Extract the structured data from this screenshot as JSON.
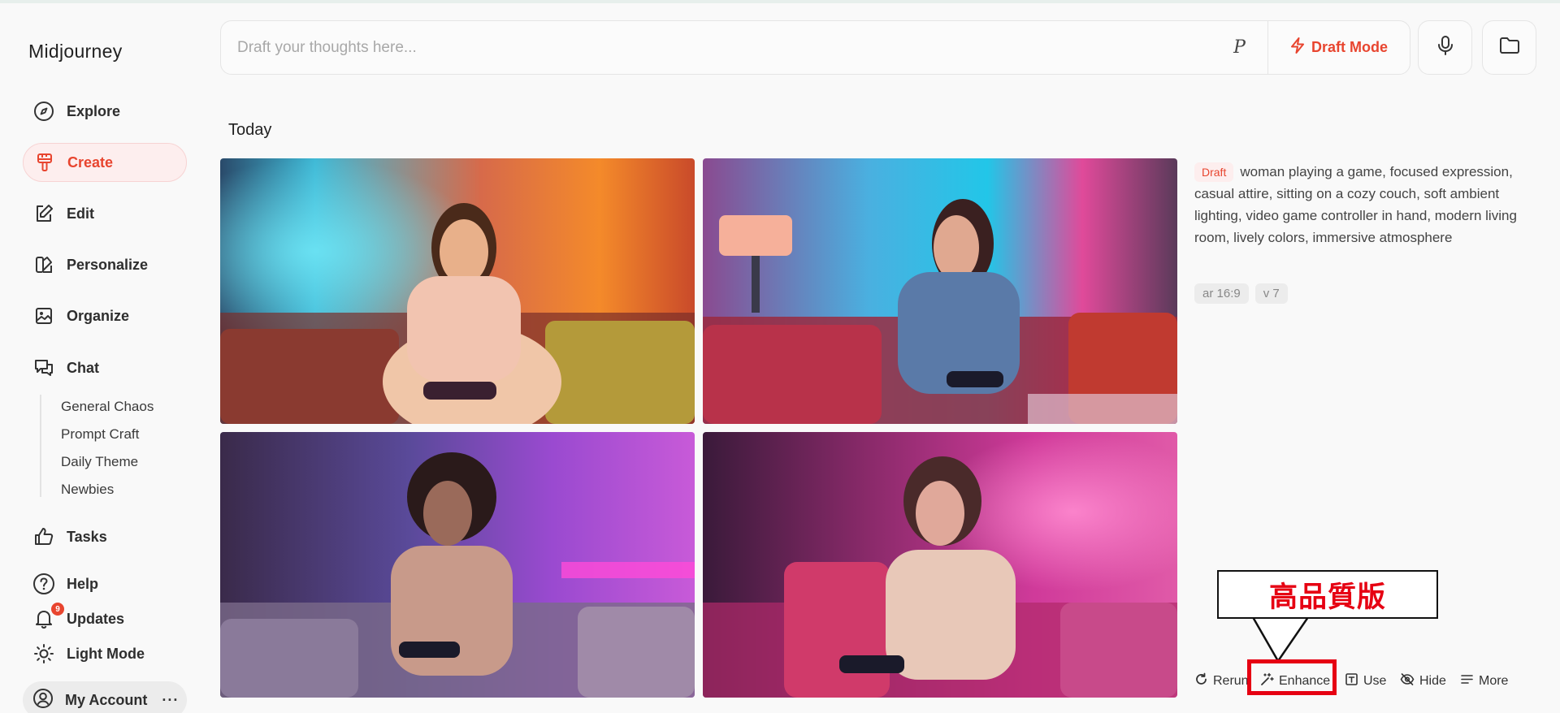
{
  "app": {
    "name": "Midjourney"
  },
  "sidebar": {
    "items": [
      {
        "label": "Explore",
        "icon": "compass-icon"
      },
      {
        "label": "Create",
        "icon": "brush-icon",
        "active": true
      },
      {
        "label": "Edit",
        "icon": "edit-icon"
      },
      {
        "label": "Personalize",
        "icon": "personalize-icon"
      },
      {
        "label": "Organize",
        "icon": "image-icon"
      },
      {
        "label": "Chat",
        "icon": "chat-icon"
      }
    ],
    "chat_rooms": [
      "General Chaos",
      "Prompt Craft",
      "Daily Theme",
      "Newbies"
    ],
    "bottom_items": [
      {
        "label": "Tasks",
        "icon": "thumbs-up-icon"
      },
      {
        "label": "Help",
        "icon": "help-icon"
      },
      {
        "label": "Updates",
        "icon": "bell-icon",
        "badge": "9"
      },
      {
        "label": "Light Mode",
        "icon": "sun-icon"
      }
    ],
    "account": {
      "label": "My Account",
      "more": "···"
    }
  },
  "prompt_bar": {
    "placeholder": "Draft your thoughts here...",
    "p_label": "P",
    "draft_mode_label": "Draft Mode"
  },
  "section": {
    "title": "Today"
  },
  "job": {
    "tag": "Draft",
    "prompt": "woman playing a game, focused expression, casual attire, sitting on a cozy couch, soft ambient lighting, video game controller in hand, modern living room, lively colors, immersive atmosphere",
    "params": [
      "ar 16:9",
      "v 7"
    ]
  },
  "actions": {
    "rerun": "Rerun",
    "enhance": "Enhance",
    "use": "Use",
    "hide": "Hide",
    "more": "More"
  },
  "annotation": {
    "text": "高品質版"
  },
  "colors": {
    "accent": "#e8452f",
    "annotation_red": "#e60012"
  }
}
